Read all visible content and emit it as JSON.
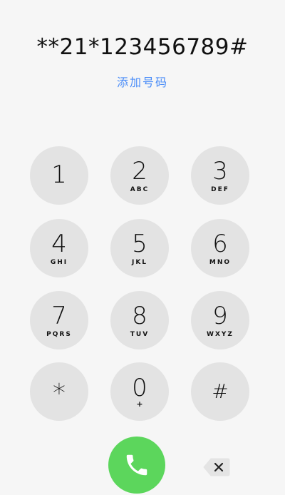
{
  "display": {
    "number": "**21*123456789#",
    "add_number_label": "添加号码"
  },
  "keypad": {
    "k1": {
      "digit": "1",
      "letters": ""
    },
    "k2": {
      "digit": "2",
      "letters": "ABC"
    },
    "k3": {
      "digit": "3",
      "letters": "DEF"
    },
    "k4": {
      "digit": "4",
      "letters": "GHI"
    },
    "k5": {
      "digit": "5",
      "letters": "JKL"
    },
    "k6": {
      "digit": "6",
      "letters": "MNO"
    },
    "k7": {
      "digit": "7",
      "letters": "PQRS"
    },
    "k8": {
      "digit": "8",
      "letters": "TUV"
    },
    "k9": {
      "digit": "9",
      "letters": "WXYZ"
    },
    "kstar": {
      "digit": "*"
    },
    "k0": {
      "digit": "0",
      "letters": "+"
    },
    "khash": {
      "digit": "#"
    }
  },
  "icons": {
    "call": "phone-handset-icon",
    "delete": "backspace-icon"
  },
  "colors": {
    "accent": "#4b8df8",
    "call_green": "#5cd65c",
    "key_bg": "#e3e3e3"
  }
}
